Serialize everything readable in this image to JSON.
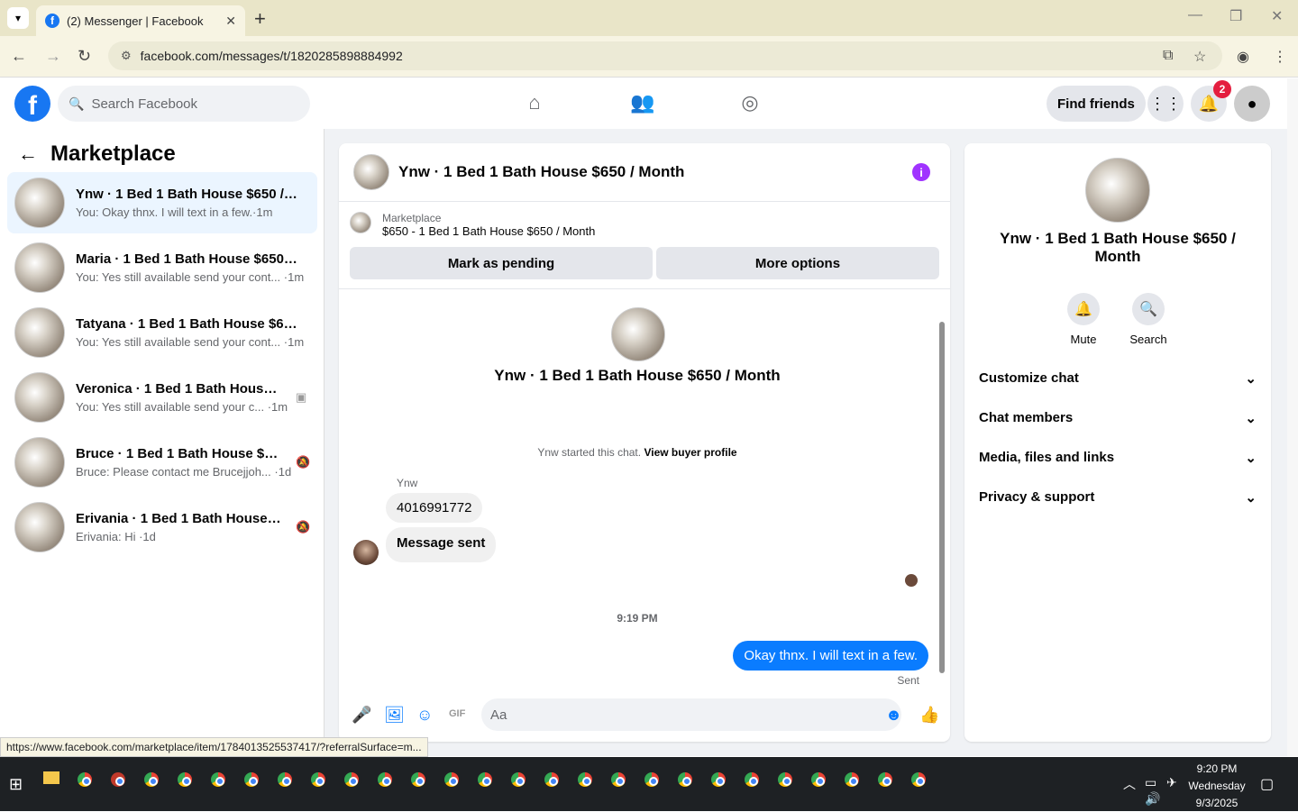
{
  "browser": {
    "tab_title": "(2) Messenger | Facebook",
    "url": "facebook.com/messages/t/1820285898884992",
    "status_url": "https://www.facebook.com/marketplace/item/1784013525537417/?referralSurface=m..."
  },
  "fb_header": {
    "search_placeholder": "Search Facebook",
    "find_friends": "Find friends",
    "notification_count": "2"
  },
  "left_panel": {
    "title": "Marketplace",
    "conversations": [
      {
        "name": "Ynw · 1 Bed 1 Bath House $650 / M...",
        "preview": "You: Okay thnx. I will text in a few.·1m"
      },
      {
        "name": "Maria · 1 Bed 1 Bath House $650 / ...",
        "preview": "You: Yes still available send your cont... ·1m"
      },
      {
        "name": "Tatyana · 1 Bed 1 Bath House $650 ...",
        "preview": "You: Yes still available send your cont... ·1m"
      },
      {
        "name": "Veronica · 1 Bed 1 Bath House $...",
        "preview": "You: Yes still available send your c... ·1m"
      },
      {
        "name": "Bruce · 1 Bed 1 Bath House $650...",
        "preview": "Bruce: Please contact me Brucejjoh... ·1d"
      },
      {
        "name": "Erivania · 1 Bed 1 Bath House $6...",
        "preview": "Erivania: Hi ·1d"
      }
    ]
  },
  "chat": {
    "header_title": "Ynw · 1 Bed 1 Bath House $650 / Month",
    "listing_label": "Marketplace",
    "listing_text": "$650 - 1 Bed 1 Bath House $650 / Month",
    "mark_pending": "Mark as pending",
    "more_options": "More options",
    "intro_title": "Ynw · 1 Bed 1 Bath House $650 / Month",
    "started_text": "Ynw started this chat.",
    "view_buyer": "View buyer profile",
    "sender_name": "Ynw",
    "msg1": "4016991772",
    "msg2": "Message sent",
    "timestamp": "9:19 PM",
    "outgoing": "Okay thnx. I will text in a few.",
    "sent_label": "Sent",
    "input_placeholder": "Aa"
  },
  "right_panel": {
    "name": "Ynw · 1 Bed 1 Bath House $650 / Month",
    "mute": "Mute",
    "search": "Search",
    "sections": [
      "Customize chat",
      "Chat members",
      "Media, files and links",
      "Privacy & support"
    ]
  },
  "taskbar": {
    "time": "9:20 PM",
    "day": "Wednesday",
    "date": "9/3/2025"
  }
}
